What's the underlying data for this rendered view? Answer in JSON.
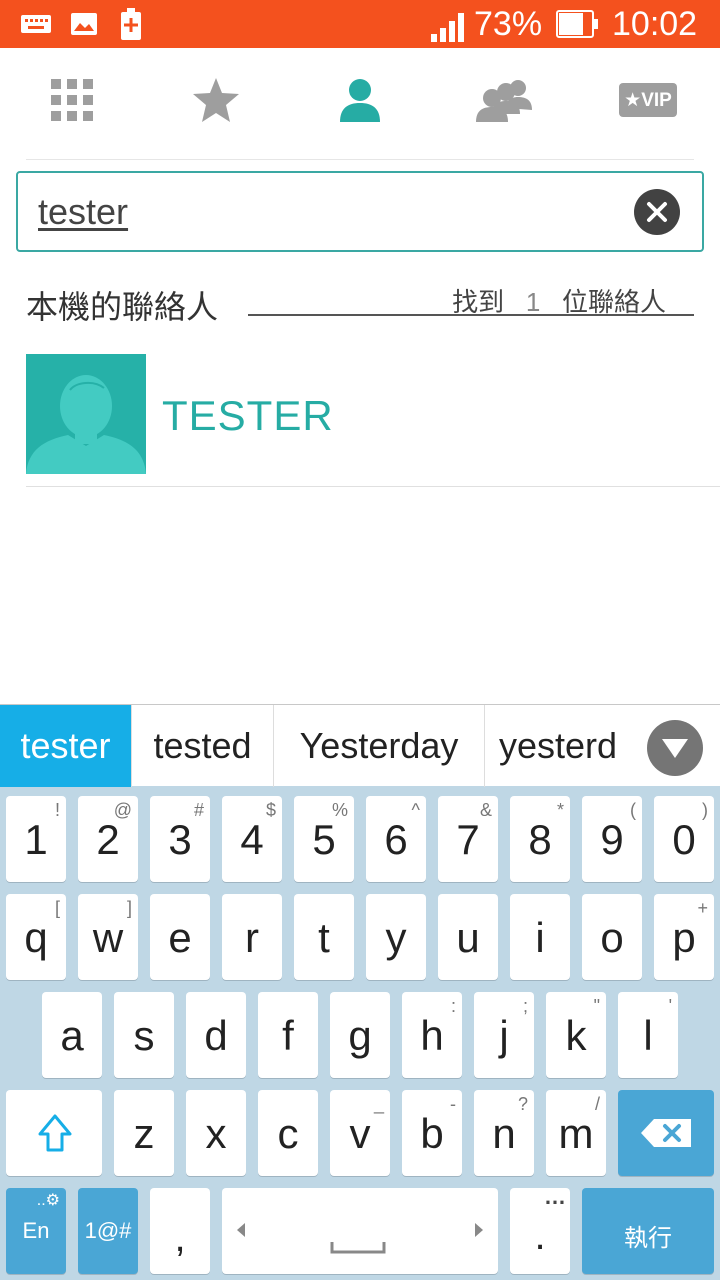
{
  "status_bar": {
    "battery": "73%",
    "time": "10:02"
  },
  "tabs": [
    {
      "icon": "grid-icon"
    },
    {
      "icon": "star-icon"
    },
    {
      "icon": "person-icon",
      "active": true
    },
    {
      "icon": "group-icon"
    },
    {
      "icon": "vip-icon",
      "label": "★VIP"
    }
  ],
  "search": {
    "value": "tester"
  },
  "section": {
    "title": "本機的聯絡人",
    "found_prefix": "找到",
    "found_count": "1",
    "found_suffix": "位聯絡人"
  },
  "contacts": [
    {
      "name": "TESTER"
    }
  ],
  "suggestions": [
    "tester",
    "tested",
    "Yesterday",
    "yesterd"
  ],
  "keyboard": {
    "row_numbers": [
      [
        "1",
        "!"
      ],
      [
        "2",
        "@"
      ],
      [
        "3",
        "#"
      ],
      [
        "4",
        "$"
      ],
      [
        "5",
        "%"
      ],
      [
        "6",
        "^"
      ],
      [
        "7",
        "&"
      ],
      [
        "8",
        "*"
      ],
      [
        "9",
        "("
      ],
      [
        "0",
        ")"
      ]
    ],
    "row_qwerty": [
      [
        "q",
        "["
      ],
      [
        "w",
        "]"
      ],
      [
        "e",
        ""
      ],
      [
        "r",
        ""
      ],
      [
        "t",
        ""
      ],
      [
        "y",
        ""
      ],
      [
        "u",
        ""
      ],
      [
        "i",
        ""
      ],
      [
        "o",
        ""
      ],
      [
        "p",
        "+"
      ]
    ],
    "row_asdf": [
      [
        "a",
        ""
      ],
      [
        "s",
        ""
      ],
      [
        "d",
        ""
      ],
      [
        "f",
        ""
      ],
      [
        "g",
        ""
      ],
      [
        "h",
        ":"
      ],
      [
        "j",
        ";"
      ],
      [
        "k",
        "\""
      ],
      [
        "l",
        "'"
      ]
    ],
    "row_zxcv": [
      [
        "z",
        ""
      ],
      [
        "x",
        ""
      ],
      [
        "c",
        ""
      ],
      [
        "v",
        "_"
      ],
      [
        "b",
        "-"
      ],
      [
        "n",
        "?"
      ],
      [
        "m",
        "/"
      ]
    ],
    "lang_label": "En",
    "symbols_label": "1@#",
    "comma_label": ",",
    "period_label": ".",
    "enter_label": "執行"
  },
  "colors": {
    "status_bar": "#f4511e",
    "accent": "#26aca4",
    "suggestion_active": "#16aee7",
    "keyboard_bg": "#bfd7e5",
    "key_blue": "#4aa6d5"
  }
}
